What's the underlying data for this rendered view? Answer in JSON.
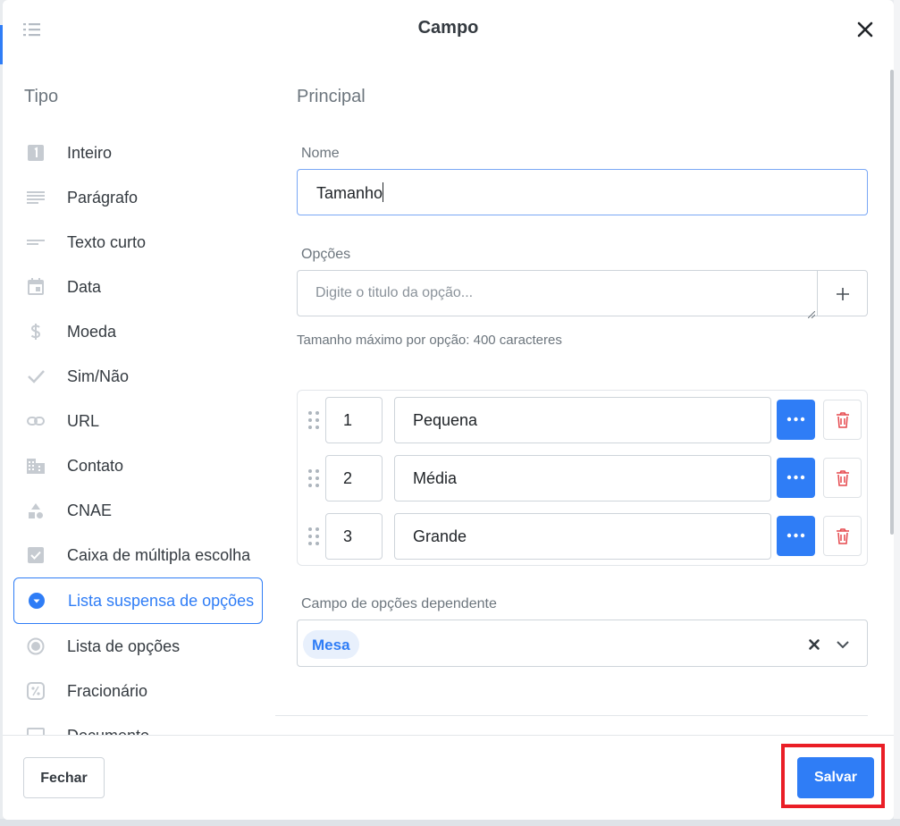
{
  "modal": {
    "title": "Campo",
    "close_icon": "close-icon",
    "menu_icon": "list-icon"
  },
  "left": {
    "heading": "Tipo",
    "types": [
      {
        "label": "Inteiro",
        "icon": "number-one-icon"
      },
      {
        "label": "Parágrafo",
        "icon": "paragraph-icon"
      },
      {
        "label": "Texto curto",
        "icon": "short-text-icon"
      },
      {
        "label": "Data",
        "icon": "calendar-icon"
      },
      {
        "label": "Moeda",
        "icon": "dollar-icon"
      },
      {
        "label": "Sim/Não",
        "icon": "check-icon"
      },
      {
        "label": "URL",
        "icon": "link-icon"
      },
      {
        "label": "Contato",
        "icon": "building-icon"
      },
      {
        "label": "CNAE",
        "icon": "shapes-icon"
      },
      {
        "label": "Caixa de múltipla escolha",
        "icon": "checkbox-icon"
      },
      {
        "label": "Lista suspensa de opções",
        "icon": "dropdown-circle-icon",
        "active": true
      },
      {
        "label": "Lista de opções",
        "icon": "radio-icon"
      },
      {
        "label": "Fracionário",
        "icon": "fraction-icon"
      },
      {
        "label": "Documento",
        "icon": "document-icon"
      }
    ]
  },
  "right": {
    "heading": "Principal",
    "nome": {
      "label": "Nome",
      "value": "Tamanho"
    },
    "opcoes": {
      "label": "Opções",
      "placeholder": "Digite o titulo da opção...",
      "hint": "Tamanho máximo por opção: 400 caracteres",
      "items": [
        {
          "number": "1",
          "name": "Pequena"
        },
        {
          "number": "2",
          "name": "Média"
        },
        {
          "number": "3",
          "name": "Grande"
        }
      ]
    },
    "dependente": {
      "label": "Campo de opções dependente",
      "selected": "Mesa"
    }
  },
  "footer": {
    "close_label": "Fechar",
    "save_label": "Salvar"
  },
  "colors": {
    "accent": "#2f7df6",
    "highlight": "#ea1e26",
    "danger": "#e5484d"
  }
}
